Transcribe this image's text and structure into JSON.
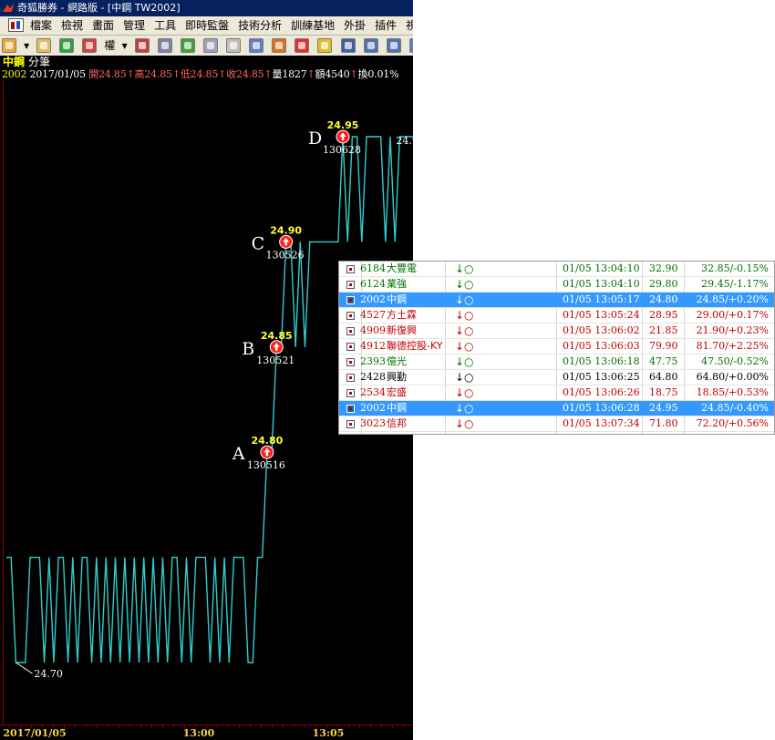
{
  "window": {
    "title": "奇狐勝券 - 網路版 - [中鋼 TW2002]"
  },
  "menu": {
    "items": [
      "檔案",
      "檢視",
      "畫面",
      "管理",
      "工具",
      "即時監盤",
      "技術分析",
      "訓練基地",
      "外掛",
      "插件",
      "視窗"
    ]
  },
  "toolbar": {
    "rights_label": "權"
  },
  "header": {
    "stock_name": "中鋼",
    "view_label": "分筆",
    "quote_line": {
      "code": "2002",
      "date": "2017/01/05",
      "open": "開24.85",
      "high": "高24.85",
      "low": "低24.85",
      "close": "收24.85",
      "volume": "量1827",
      "amount": "額4540",
      "turnover": "換0.01%"
    }
  },
  "chart_data": {
    "type": "line",
    "title": "",
    "series_color": "#33cccc",
    "x_axis_labels": [
      "2017/01/05",
      "13:00",
      "13:05"
    ],
    "low_marker": {
      "label": "24.70",
      "value": 24.7
    },
    "top_marker": {
      "label": "24.95",
      "value": 24.95
    },
    "annotations": [
      {
        "letter": "A",
        "price": "24.80",
        "time": "130516"
      },
      {
        "letter": "B",
        "price": "24.85",
        "time": "130521"
      },
      {
        "letter": "C",
        "price": "24.90",
        "time": "130526"
      },
      {
        "letter": "D",
        "price": "24.95",
        "time": "130628"
      }
    ],
    "price_levels": [
      24.7,
      24.75,
      24.8,
      24.85,
      24.9,
      24.95
    ],
    "ticks": [
      24.75,
      24.75,
      24.7,
      24.7,
      24.7,
      24.75,
      24.75,
      24.75,
      24.7,
      24.75,
      24.7,
      24.75,
      24.75,
      24.7,
      24.75,
      24.7,
      24.75,
      24.75,
      24.7,
      24.75,
      24.7,
      24.75,
      24.7,
      24.75,
      24.7,
      24.75,
      24.7,
      24.75,
      24.7,
      24.75,
      24.7,
      24.75,
      24.7,
      24.75,
      24.7,
      24.75,
      24.75,
      24.7,
      24.75,
      24.7,
      24.75,
      24.75,
      24.75,
      24.7,
      24.75,
      24.7,
      24.75,
      24.7,
      24.75,
      24.75,
      24.75,
      24.7,
      24.7,
      24.75,
      24.75,
      24.8,
      24.8,
      24.85,
      24.85,
      24.9,
      24.9,
      24.85,
      24.9,
      24.85,
      24.9,
      24.9,
      24.9,
      24.9,
      24.9,
      24.9,
      24.9,
      24.95,
      24.9,
      24.95,
      24.95,
      24.9,
      24.95,
      24.95,
      24.95,
      24.95,
      24.9,
      24.95,
      24.9,
      24.95,
      24.95,
      24.95,
      24.95
    ]
  },
  "quote_list": {
    "rows": [
      {
        "code": "6184",
        "name": "大豐電",
        "arrow": "↓○",
        "time": "01/05 13:04:10",
        "price": "32.90",
        "change": "32.85/-0.15%",
        "dir": "down",
        "selected": false
      },
      {
        "code": "6124",
        "name": "業強",
        "arrow": "↓○",
        "time": "01/05 13:04:10",
        "price": "29.80",
        "change": "29.45/-1.17%",
        "dir": "down",
        "selected": false
      },
      {
        "code": "2002",
        "name": "中鋼",
        "arrow": "↓○",
        "time": "01/05 13:05:17",
        "price": "24.80",
        "change": "24.85/+0.20%",
        "dir": "up",
        "selected": true
      },
      {
        "code": "4527",
        "name": "方土霖",
        "arrow": "↓○",
        "time": "01/05 13:05:24",
        "price": "28.95",
        "change": "29.00/+0.17%",
        "dir": "up",
        "selected": false
      },
      {
        "code": "4909",
        "name": "新復興",
        "arrow": "↓○",
        "time": "01/05 13:06:02",
        "price": "21.85",
        "change": "21.90/+0.23%",
        "dir": "up",
        "selected": false
      },
      {
        "code": "4912",
        "name": "聯德控股-KY",
        "arrow": "↓○",
        "time": "01/05 13:06:03",
        "price": "79.90",
        "change": "81.70/+2.25%",
        "dir": "up",
        "selected": false
      },
      {
        "code": "2393",
        "name": "億光",
        "arrow": "↓○",
        "time": "01/05 13:06:18",
        "price": "47.75",
        "change": "47.50/-0.52%",
        "dir": "down",
        "selected": false
      },
      {
        "code": "2428",
        "name": "興勤",
        "arrow": "↓○",
        "time": "01/05 13:06:25",
        "price": "64.80",
        "change": "64.80/+0.00%",
        "dir": "flat",
        "selected": false
      },
      {
        "code": "2534",
        "name": "宏盛",
        "arrow": "↓○",
        "time": "01/05 13:06:26",
        "price": "18.75",
        "change": "18.85/+0.53%",
        "dir": "up",
        "selected": false
      },
      {
        "code": "2002",
        "name": "中鋼",
        "arrow": "↓○",
        "time": "01/05 13:06:28",
        "price": "24.95",
        "change": "24.85/-0.40%",
        "dir": "down",
        "selected": true
      },
      {
        "code": "3023",
        "name": "信邦",
        "arrow": "↓○",
        "time": "01/05 13:07:34",
        "price": "71.80",
        "change": "72.20/+0.56%",
        "dir": "up",
        "selected": false
      }
    ]
  },
  "colors": {
    "chart_bg": "#000000",
    "line": "#33cccc",
    "marker": "#ff2020",
    "price_label": "#ffff33",
    "axis": "#8b0000",
    "axis_text": "#ffcc44",
    "up": "#c00000",
    "down": "#007000",
    "selected_row": "#3399ff"
  }
}
